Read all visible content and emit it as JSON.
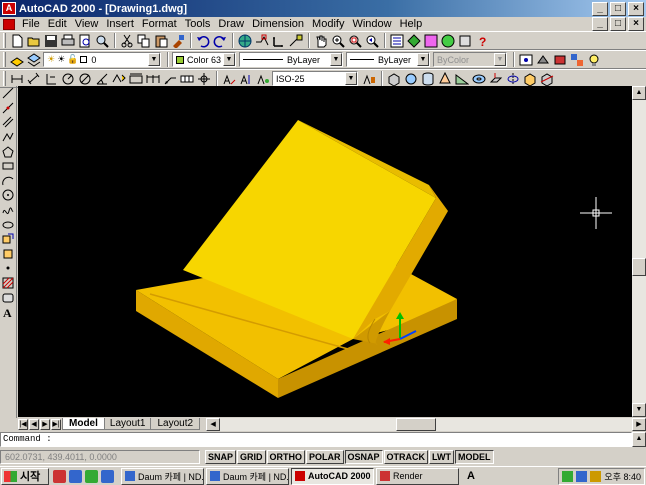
{
  "window": {
    "title": "AutoCAD 2000 - [Drawing1.dwg]",
    "app_icon": "A",
    "min": "_",
    "max": "□",
    "close": "×"
  },
  "menu": {
    "items": [
      "File",
      "Edit",
      "View",
      "Insert",
      "Format",
      "Tools",
      "Draw",
      "Dimension",
      "Modify",
      "Window",
      "Help"
    ],
    "doc_min": "_",
    "doc_max": "□",
    "doc_close": "×"
  },
  "properties_bar": {
    "layer": "0",
    "color": "Color 63",
    "linetype": "ByLayer",
    "lineweight": "ByLayer",
    "plotstyle": "ByColor"
  },
  "dimension_bar": {
    "dimstyle": "ISO-25"
  },
  "layout_tabs": {
    "tabs": [
      "Model",
      "Layout1",
      "Layout2"
    ],
    "active": "Model"
  },
  "command": {
    "prompt": "Command :"
  },
  "status": {
    "coords": "602.0731, 439.4011, 0.0000",
    "buttons": [
      "SNAP",
      "GRID",
      "ORTHO",
      "POLAR",
      "OSNAP",
      "OTRACK",
      "LWT",
      "MODEL"
    ]
  },
  "taskbar": {
    "start": "시작",
    "tasks": [
      "Daum 카페 | ND...",
      "Daum 카페 | ND...",
      "AutoCAD 2000 - ...",
      "Render"
    ],
    "active_task": 2,
    "tray_letter": "A",
    "clock": "오후 8:40"
  },
  "colors": {
    "model_face_top": "#f5d300",
    "model_face_front": "#e0ae00",
    "model_face_side": "#c89a00",
    "viewport_bg": "#000000",
    "titlebar_start": "#0a246a"
  }
}
